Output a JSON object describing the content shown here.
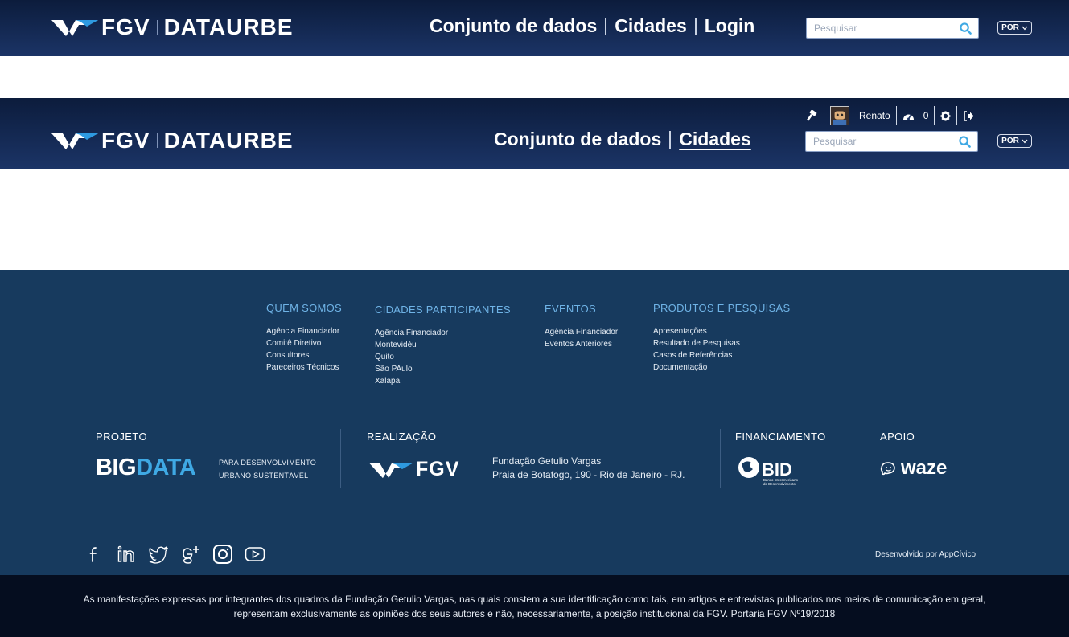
{
  "brand": {
    "fgv": "FGV",
    "product": "DATAURBE"
  },
  "header1": {
    "nav": [
      "Conjunto de dados",
      "Cidades",
      "Login"
    ],
    "search_placeholder": "Pesquisar",
    "lang": "POR"
  },
  "header2": {
    "nav": [
      "Conjunto de dados",
      "Cidades"
    ],
    "search_placeholder": "Pesquisar",
    "lang": "POR",
    "user": {
      "name": "Renato",
      "notifications": "0"
    }
  },
  "footer": {
    "columns": [
      {
        "title": "QUEM SOMOS",
        "items": [
          "Agência Financiador",
          "Comitê Diretivo",
          "Consultores",
          "Pareceiros Técnicos"
        ]
      },
      {
        "title": "CIDADES PARTICIPANTES",
        "items": [
          "Agência Financiador",
          "Montevidéu",
          "Quito",
          "São PAulo",
          "Xalapa"
        ]
      },
      {
        "title": "EVENTOS",
        "items": [
          "Agência Financiador",
          "Eventos Anteriores"
        ]
      },
      {
        "title": "PRODUTOS E PESQUISAS",
        "items": [
          "Apresentações",
          "Resultado de Pesquisas",
          "Casos de Referências",
          "Documentação"
        ]
      }
    ],
    "partners": {
      "projeto_title": "PROJETO",
      "bigdata_big": "BIG",
      "bigdata_data": "DATA",
      "bigdata_sub1": "PARA DESENVOLVIMENTO",
      "bigdata_sub2": "URBANO SUSTENTÁVEL",
      "realizacao_title": "REALIZAÇÃO",
      "realizacao_fgv": "FGV",
      "realizacao_name": "Fundação Getulio Vargas",
      "realizacao_address": "Praia de Botafogo, 190 - Rio de Janeiro - RJ.",
      "financiamento_title": "FINANCIAMENTO",
      "bid_name": "BID",
      "bid_sub1": "Banco Interamericano",
      "bid_sub2": "de Desenvolvimento",
      "apoio_title": "APOIO",
      "waze": "waze"
    },
    "developed_by": "Desenvolvido por AppCívico",
    "disclaimer": "As manifestações expressas por integrantes dos quadros da Fundação Getulio Vargas, nas quais constem a sua identificação como tais, em artigos e entrevistas publicados nos meios de comunicação em geral, representam exclusivamente as opiniões dos seus autores e não, necessariamente, a posição institucional da FGV. Portaria FGV Nº19/2018"
  },
  "colors": {
    "header_dark": "#0c1c3c",
    "header_light": "#1b3466",
    "footer_bg": "#173a5e",
    "footer_heading": "#6fb3e6",
    "bigdata_accent": "#3fa9e4",
    "bottom_bar": "#050d1f"
  },
  "icons": [
    "search-icon",
    "chevron-down-icon",
    "hammer-icon",
    "avatar",
    "dashboard-icon",
    "gear-icon",
    "logout-icon",
    "facebook-icon",
    "linkedin-icon",
    "twitter-icon",
    "google-plus-icon",
    "instagram-icon",
    "youtube-icon",
    "waze-icon"
  ]
}
